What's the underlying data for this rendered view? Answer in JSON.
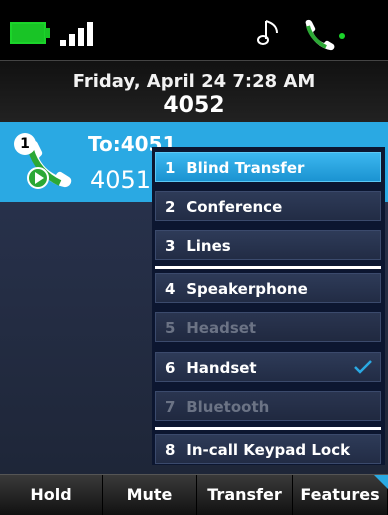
{
  "status": {
    "battery_icon": "battery-icon",
    "signal_icon": "signal-icon",
    "ringer_icon": "music-note-icon",
    "registration_icon": "handset-registered-icon",
    "accent": "#19c426"
  },
  "header": {
    "datetime": "Friday, April 24 7:28 AM",
    "extension": "4052"
  },
  "call": {
    "badge": "1",
    "to_label": "To:4051",
    "number": "4051",
    "icon": "active-call-icon"
  },
  "menu": {
    "items": [
      {
        "num": "1",
        "label": "Blind Transfer",
        "selected": true,
        "disabled": false
      },
      {
        "num": "2",
        "label": "Conference",
        "selected": false,
        "disabled": false
      },
      {
        "num": "3",
        "label": "Lines",
        "selected": false,
        "disabled": false
      },
      {
        "num": "4",
        "label": "Speakerphone",
        "selected": false,
        "disabled": false
      },
      {
        "num": "5",
        "label": "Headset",
        "selected": false,
        "disabled": true
      },
      {
        "num": "6",
        "label": "Handset",
        "selected": false,
        "disabled": false,
        "checked": true
      },
      {
        "num": "7",
        "label": "Bluetooth",
        "selected": false,
        "disabled": true
      },
      {
        "num": "8",
        "label": "In-call Keypad Lock",
        "selected": false,
        "disabled": false
      }
    ]
  },
  "softkeys": [
    "Hold",
    "Mute",
    "Transfer",
    "Features"
  ],
  "colors": {
    "selection": "#2aa9e3",
    "check": "#2aa9e3"
  }
}
